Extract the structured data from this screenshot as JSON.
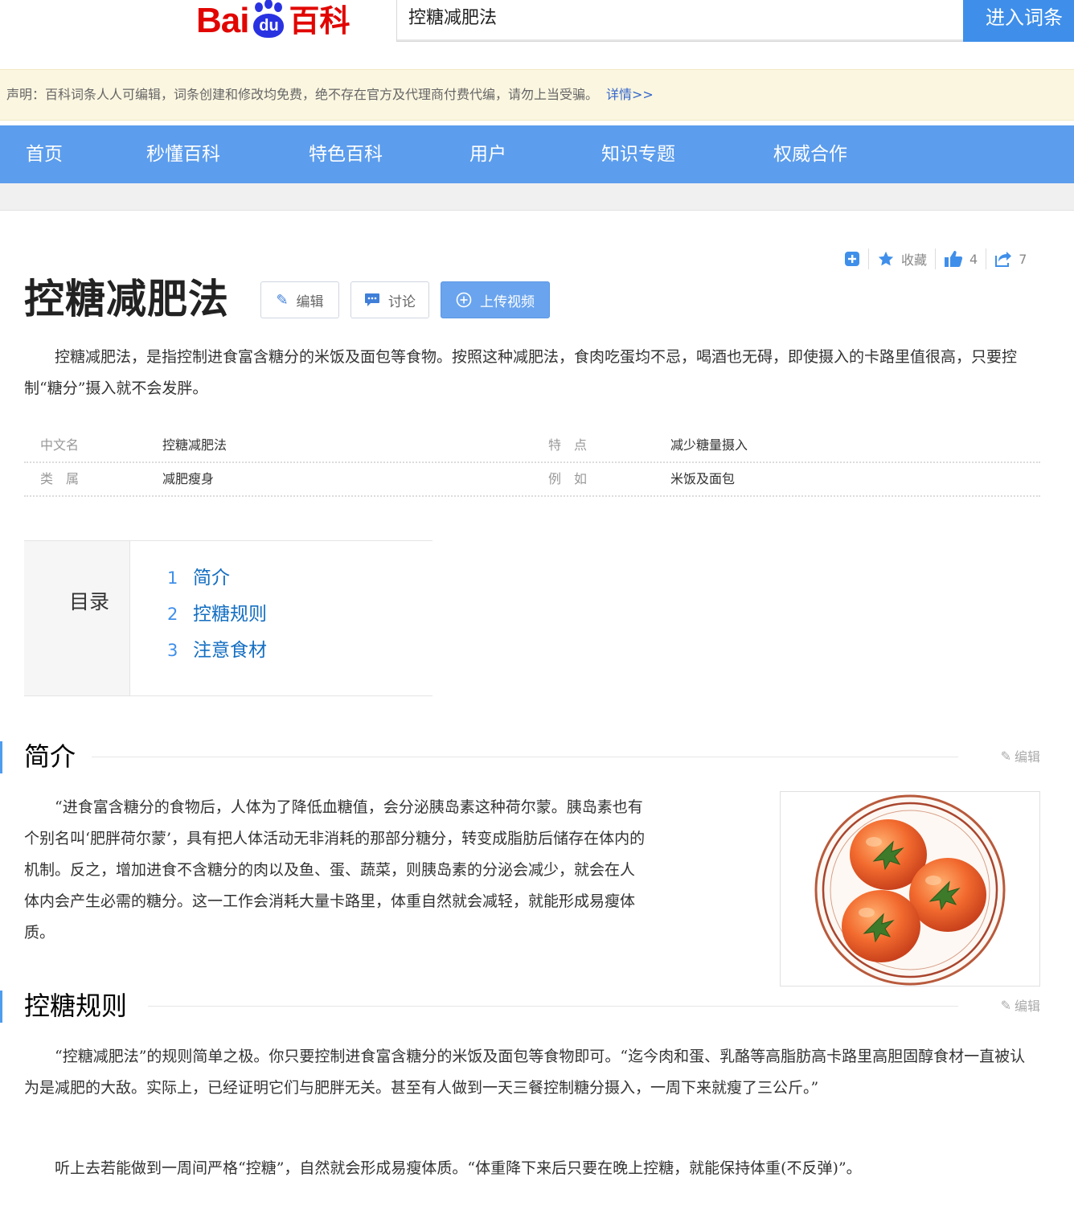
{
  "search": {
    "query": "控糖减肥法",
    "button_label": "进入词条"
  },
  "notice": {
    "text": "声明：百科词条人人可编辑，词条创建和修改均免费，绝不存在官方及代理商付费代编，请勿上当受骗。",
    "more_label": "详情>>"
  },
  "nav": {
    "items": [
      "首页",
      "秒懂百科",
      "特色百科",
      "用户",
      "知识专题",
      "权威合作"
    ]
  },
  "tools": {
    "collect_label": "收藏",
    "like_count": "4",
    "share_count": "7"
  },
  "entry": {
    "title": "控糖减肥法",
    "edit_label": "编辑",
    "discuss_label": "讨论",
    "upload_label": "上传视频",
    "summary": "控糖减肥法，是指控制进食富含糖分的米饭及面包等食物。按照这种减肥法，食肉吃蛋均不忌，喝酒也无碍，即使摄入的卡路里值很高，只要控制“糖分”摄入就不会发胖。"
  },
  "basic_info": [
    {
      "key": "中文名",
      "value": "控糖减肥法"
    },
    {
      "key": "特　点",
      "value": "减少糖量摄入"
    },
    {
      "key": "类　属",
      "value": "减肥瘦身"
    },
    {
      "key": "例　如",
      "value": "米饭及面包"
    }
  ],
  "catalog": {
    "title": "目录",
    "items": [
      {
        "num": "1",
        "label": "简介"
      },
      {
        "num": "2",
        "label": "控糖规则"
      },
      {
        "num": "3",
        "label": "注意食材"
      }
    ]
  },
  "sections": [
    {
      "title": "简介",
      "edit_label": "编辑",
      "lines": [
        "“进食富含糖分的食物后，人体为了降低血糖值，会分泌胰岛素这种荷尔蒙。胰岛素也有",
        "个别名叫‘肥胖荷尔蒙’，具有把人体活动无非消耗的那部分糖分，转变成脂肪后储存在体内的",
        "机制。反之，增加进食不含糖分的肉以及鱼、蛋、蔬菜，则胰岛素的分泌会减少，就会在人",
        "体内会产生必需的糖分。这一工作会消耗大量卡路里，体重自然就会减轻，就能形成易瘦体",
        "质。"
      ]
    },
    {
      "title": "控糖规则",
      "edit_label": "编辑",
      "text": "“控糖减肥法”的规则简单之极。你只要控制进食富含糖分的米饭及面包等食物即可。“迄今肉和蛋、乳酪等高脂肪高卡路里高胆固醇食材一直被认为是减肥的大敌。实际上，已经证明它们与肥胖无关。甚至有人做到一天三餐控制糖分摄入，一周下来就瘦了三公斤。”",
      "text2": "听上去若能做到一周间严格“控糖”，自然就会形成易瘦体质。“体重降下来后只要在晚上控糖，就能保持体重(不反弹)”。"
    }
  ],
  "colors": {
    "brand_red": "#e10602",
    "brand_blue": "#2932e1",
    "nav_blue": "#5c9ded",
    "link_blue": "#136ec2"
  }
}
